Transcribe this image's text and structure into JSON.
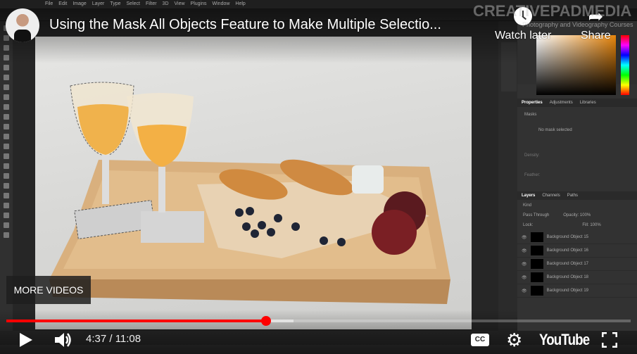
{
  "photoshop": {
    "menu": [
      "File",
      "Edit",
      "Image",
      "Layer",
      "Type",
      "Select",
      "Filter",
      "3D",
      "View",
      "Plugins",
      "Window",
      "Help"
    ],
    "properties_tabs": [
      "Properties",
      "Adjustments",
      "Libraries"
    ],
    "masks_label": "Masks",
    "no_mask_label": "No mask selected",
    "density_label": "Density:",
    "feather_label": "Feather:",
    "layers_tabs": [
      "Layers",
      "Channels",
      "Paths"
    ],
    "kind_label": "Kind",
    "blend_mode": "Pass Through",
    "opacity": "Opacity: 100%",
    "lock_label": "Lock:",
    "fill": "Fill: 100%",
    "layers": [
      "Background Object 15",
      "Background Object 16",
      "Background Object 17",
      "Background Object 18",
      "Background Object 19"
    ]
  },
  "watermark": {
    "brand": "CREATIVEPADMEDIA",
    "tagline": "Photography and Videography Courses"
  },
  "player": {
    "title": "Using the Mask All Objects Feature to Make Multiple Selectio...",
    "watch_later": "Watch later",
    "share": "Share",
    "more_videos": "MORE VIDEOS",
    "current_time": "4:37",
    "duration": "11:08",
    "time_display": "4:37 / 11:08",
    "played_fraction": 0.4164,
    "buffered_fraction": 0.46,
    "youtube_logo": "YouTube",
    "accent_color": "#ff0000"
  }
}
